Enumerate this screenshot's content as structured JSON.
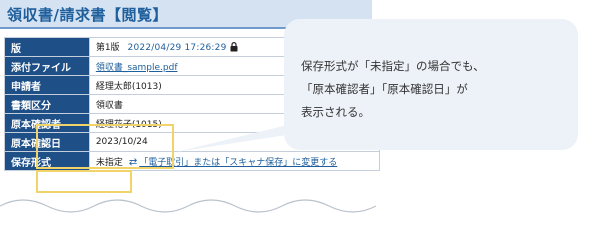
{
  "page": {
    "title": "領収書/請求書【閲覧】"
  },
  "table": {
    "rows": {
      "version": {
        "label": "版",
        "value": "第1版",
        "timestamp": "2022/04/29 17:26:29"
      },
      "attachment": {
        "label": "添付ファイル",
        "value": "領収書_sample.pdf"
      },
      "applicant": {
        "label": "申請者",
        "value": "経理太郎(1013)"
      },
      "doc_type": {
        "label": "書類区分",
        "value": "領収書"
      },
      "confirmer": {
        "label": "原本確認者",
        "value": "経理花子(1015)"
      },
      "confirm_date": {
        "label": "原本確認日",
        "value": "2023/10/24"
      },
      "storage": {
        "label": "保存形式",
        "value": "未指定",
        "change_link": "「電子取引」または「スキャナ保存」に変更する"
      }
    }
  },
  "callout": {
    "lines": [
      "保存形式が「未指定」の場合でも、",
      "「原本確認者」「原本確認日」が",
      "表示される。"
    ]
  },
  "icons": {
    "lock": "lock-icon",
    "change": "change-arrows-icon"
  },
  "colors": {
    "label_bg": "#1e4f87",
    "title_bg": "#d5e2f2",
    "title_text": "#1f5f9c",
    "highlight": "#f0d46a",
    "callout_bg": "#edf2f8"
  }
}
